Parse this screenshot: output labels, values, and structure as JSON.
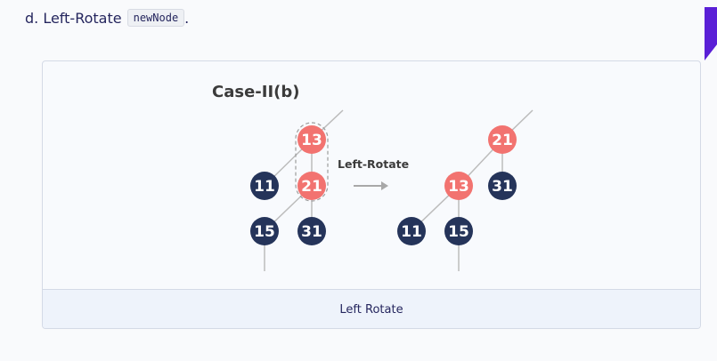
{
  "step": {
    "label": "d. Left-Rotate",
    "code": "newNode",
    "suffix": "."
  },
  "figure": {
    "title": "Case-II(b)",
    "arrow_label": "Left-Rotate",
    "caption": "Left Rotate"
  },
  "nodes": {
    "before_13": "13",
    "before_11": "11",
    "before_21": "21",
    "before_15": "15",
    "before_31": "31",
    "after_21": "21",
    "after_13": "13",
    "after_31": "31",
    "after_11": "11",
    "after_15": "15"
  },
  "colors": {
    "red_node": "#f27370",
    "dark_node": "#25345a",
    "edge": "#bcbcbc",
    "accent": "#5a1fd6"
  }
}
